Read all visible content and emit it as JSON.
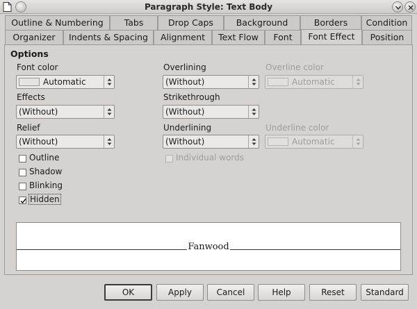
{
  "window": {
    "title": "Paragraph Style: Text Body"
  },
  "tabs": {
    "row1": [
      "Outline & Numbering",
      "Tabs",
      "Drop Caps",
      "Background",
      "Borders",
      "Condition"
    ],
    "row2": [
      "Organizer",
      "Indents & Spacing",
      "Alignment",
      "Text Flow",
      "Font",
      "Font Effect",
      "Position"
    ],
    "active": "Font Effect"
  },
  "options": {
    "heading": "Options",
    "font_color": {
      "label": "Font color",
      "value": "Automatic"
    },
    "effects": {
      "label": "Effects",
      "value": "(Without)"
    },
    "relief": {
      "label": "Relief",
      "value": "(Without)"
    },
    "overlining": {
      "label": "Overlining",
      "value": "(Without)"
    },
    "overline_color": {
      "label": "Overline color",
      "value": "Automatic"
    },
    "strikethrough": {
      "label": "Strikethrough",
      "value": "(Without)"
    },
    "underlining": {
      "label": "Underlining",
      "value": "(Without)"
    },
    "underline_color": {
      "label": "Underline color",
      "value": "Automatic"
    },
    "checkboxes": [
      {
        "label": "Outline",
        "checked": false
      },
      {
        "label": "Shadow",
        "checked": false
      },
      {
        "label": "Blinking",
        "checked": false
      },
      {
        "label": "Hidden",
        "checked": true
      }
    ],
    "individual_words": {
      "label": "Individual words",
      "checked": false,
      "disabled": true
    }
  },
  "preview": {
    "text": "Fanwood"
  },
  "buttons": {
    "ok": "OK",
    "apply": "Apply",
    "cancel": "Cancel",
    "help": "Help",
    "reset": "Reset",
    "standard": "Standard"
  }
}
